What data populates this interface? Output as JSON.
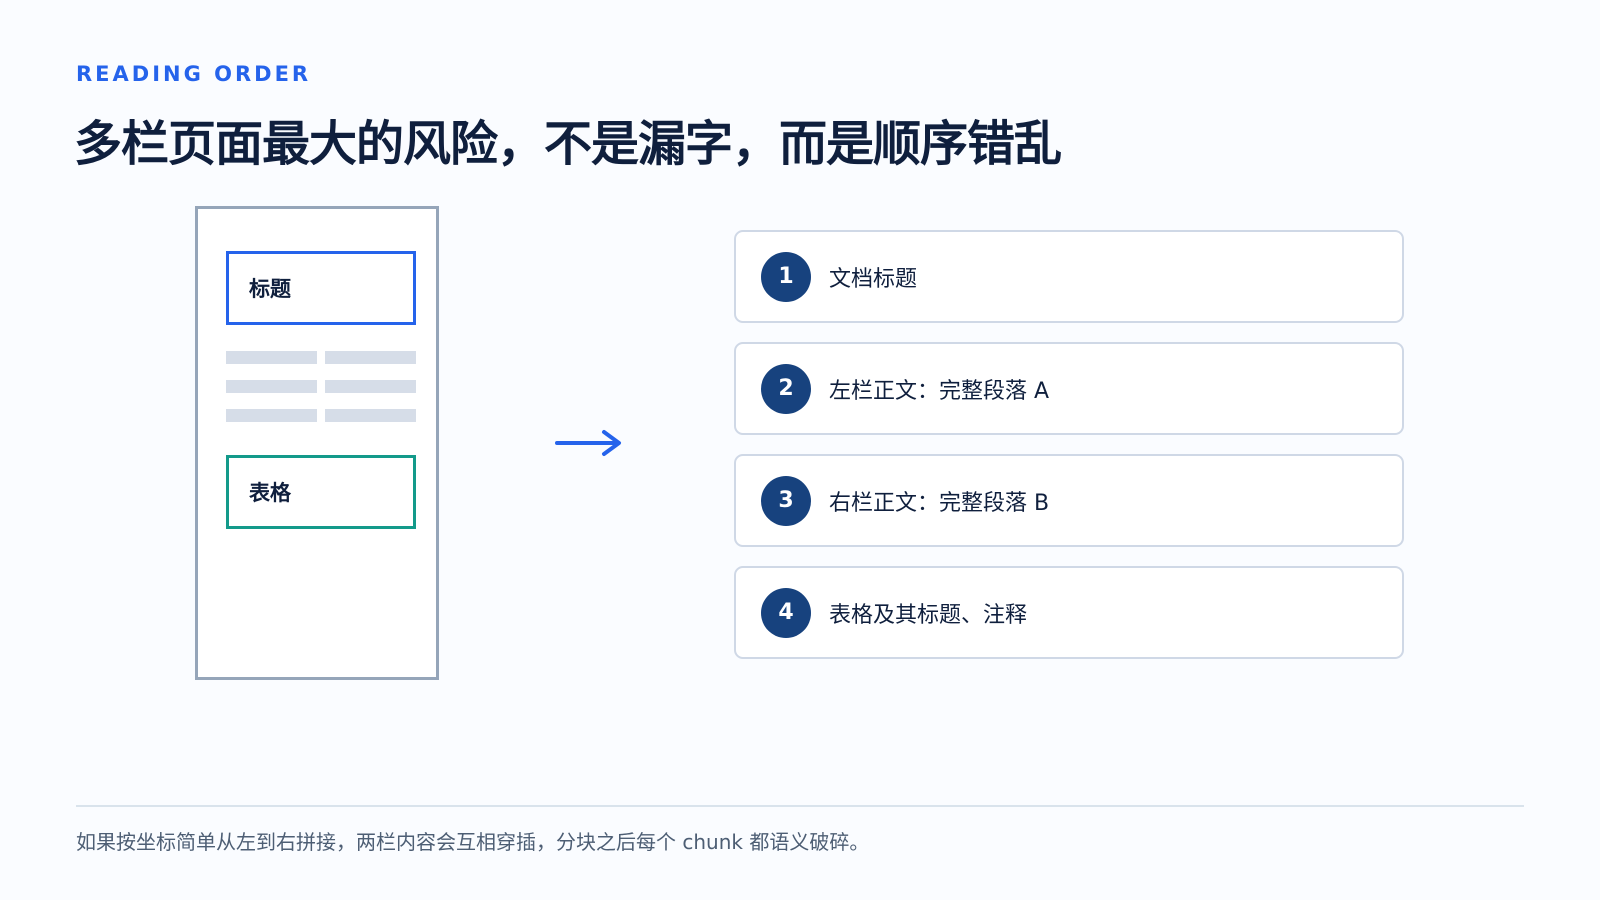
{
  "eyebrow": "READING ORDER",
  "title": "多栏页面最大的风险，不是漏字，而是顺序错乱",
  "page_mockup": {
    "title_block_label": "标题",
    "table_block_label": "表格",
    "line_icon": "paragraph-line",
    "accent_title": "#2563eb",
    "accent_table": "#139a8a"
  },
  "arrow_icon": "right-arrow",
  "reading_order": [
    {
      "number": "1",
      "label": "文档标题"
    },
    {
      "number": "2",
      "label": "左栏正文：完整段落 A"
    },
    {
      "number": "3",
      "label": "右栏正文：完整段落 B"
    },
    {
      "number": "4",
      "label": "表格及其标题、注释"
    }
  ],
  "footnote": "如果按坐标简单从左到右拼接，两栏内容会互相穿插，分块之后每个 chunk 都语义破碎。",
  "colors": {
    "eyebrow": "#2563eb",
    "badge": "#17427e",
    "background": "#fafcff"
  }
}
